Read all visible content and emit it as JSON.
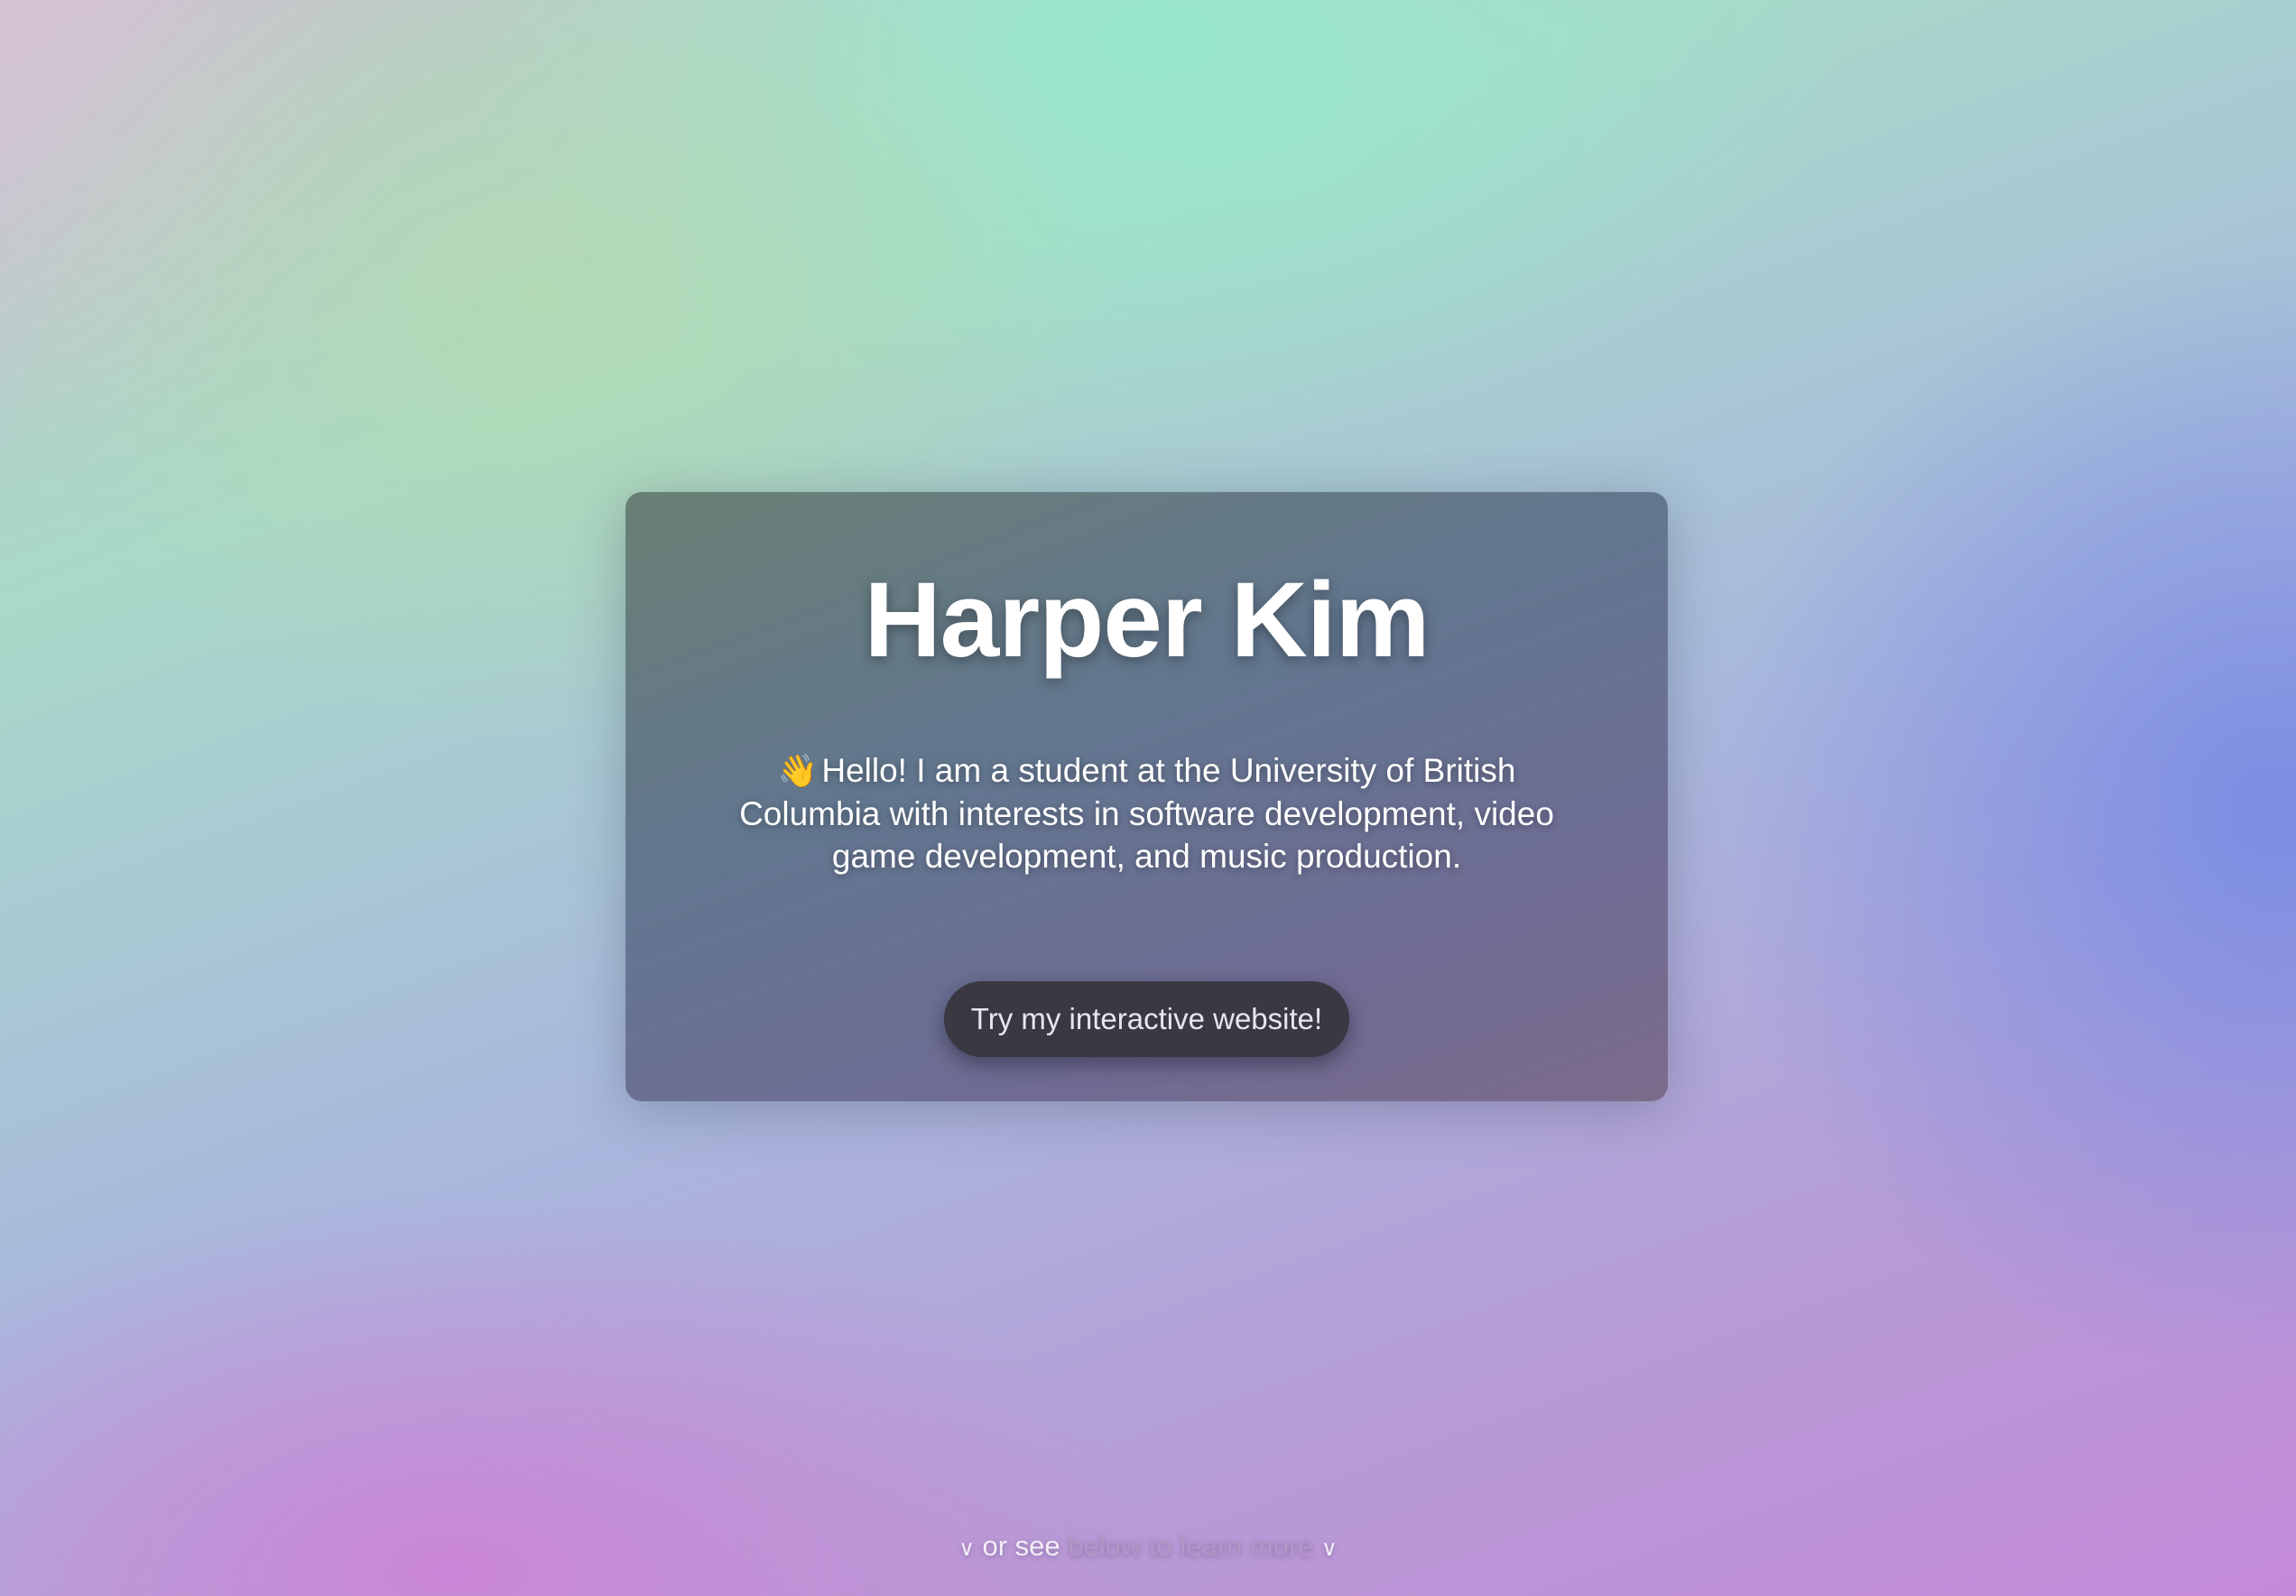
{
  "hero": {
    "name": "Harper Kim",
    "wave_emoji": "👋",
    "intro": "Hello! I am a student at the University of British Columbia with interests in software development, video game development, and music production.",
    "cta_label": "Try my interactive website!"
  },
  "footer": {
    "chevron": "∨",
    "hint_strong": "or see",
    "hint_faded": "below to learn more"
  },
  "icons": {
    "wave": "waving-hand-icon",
    "chevron": "chevron-down-icon"
  },
  "colors": {
    "card_bg": "#5f6b82",
    "button_bg": "#3a3843",
    "title_text": "#ffffff"
  }
}
